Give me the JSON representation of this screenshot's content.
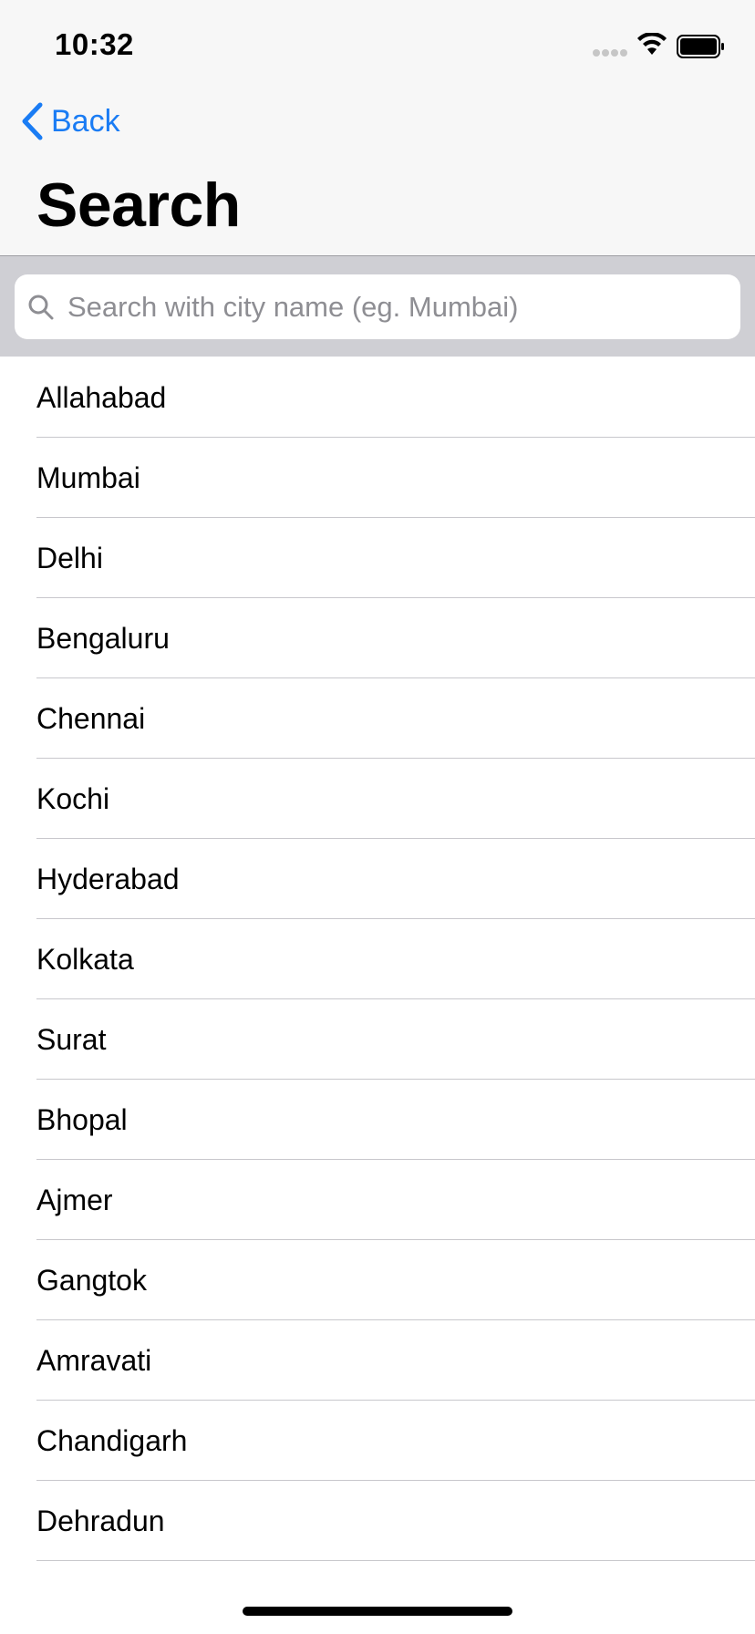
{
  "status_bar": {
    "time": "10:32",
    "icons": [
      "signal-icon",
      "wifi-icon",
      "battery-icon"
    ]
  },
  "nav": {
    "back_label": "Back",
    "title": "Search"
  },
  "search": {
    "placeholder": "Search with city name (eg. Mumbai)",
    "value": ""
  },
  "cities": [
    "Allahabad",
    "Mumbai",
    "Delhi",
    "Bengaluru",
    "Chennai",
    "Kochi",
    "Hyderabad",
    "Kolkata",
    "Surat",
    "Bhopal",
    "Ajmer",
    "Gangtok",
    "Amravati",
    "Chandigarh",
    "Dehradun"
  ],
  "colors": {
    "accent": "#1a7cf4",
    "header_bg": "#f7f7f7",
    "search_bar_bg": "#cfcfd4",
    "separator": "#c8c7cc"
  }
}
